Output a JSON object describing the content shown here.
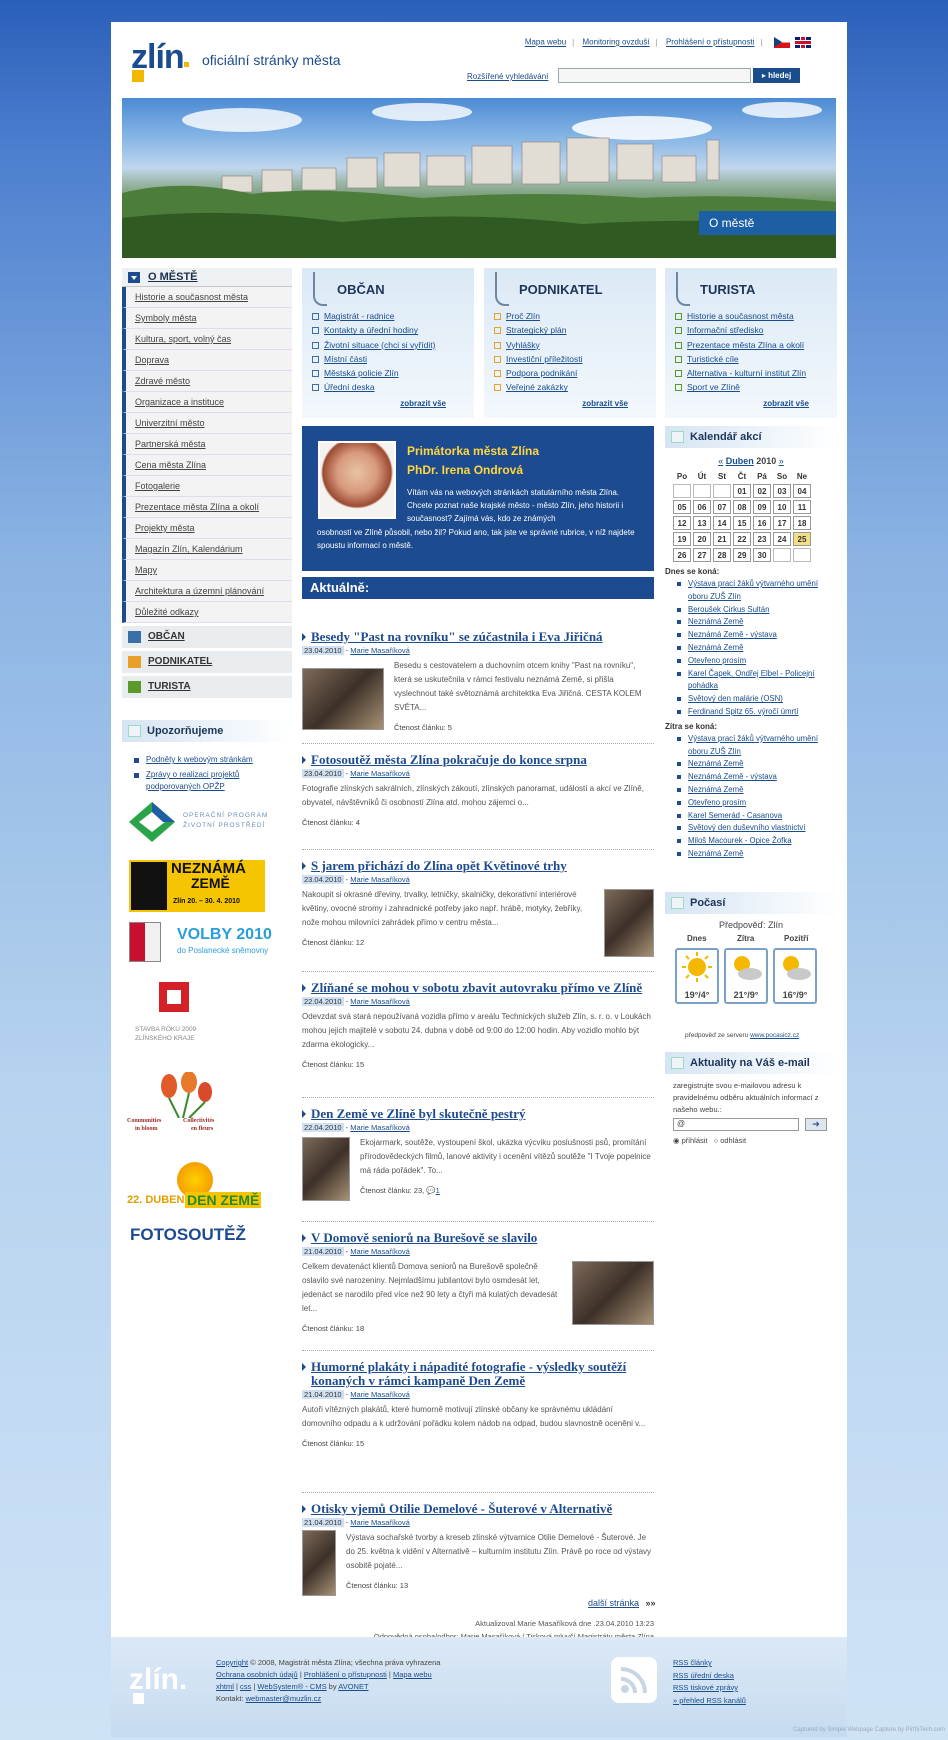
{
  "header": {
    "logo_text": "zlín",
    "tagline": "oficiální stránky města",
    "top_links": [
      "Mapa webu",
      "Monitoring ovzduší",
      "Prohlášení o přístupnosti"
    ],
    "adv_search": "Rozšířené vyhledávání",
    "search_button": "hledej",
    "banner_label": "O městě"
  },
  "left_nav": {
    "heading": "O MĚSTĚ",
    "items": [
      "Historie a současnost města",
      "Symboly města",
      "Kultura, sport, volný čas",
      "Doprava",
      "Zdravé město",
      "Organizace a instituce",
      "Univerzitní město",
      "Partnerská města",
      "Cena města Zlína",
      "Fotogalerie",
      "Prezentace města Zlína a okolí",
      "Projekty města",
      "Magazín Zlín, Kalendárium",
      "Mapy",
      "Architektura a územní plánování",
      "Důležité odkazy"
    ],
    "sections": [
      "OBČAN",
      "PODNIKATEL",
      "TURISTA"
    ]
  },
  "upozornujeme": {
    "heading": "Upozorňujeme",
    "links": [
      "Podněty k webovým stránkám",
      "Zprávy o realizaci projektů podporovaných OPŽP"
    ],
    "promo1_a": "OPERAČNÍ PROGRAM",
    "promo1_b": "ŽIVOTNÍ PROSTŘEDÍ",
    "promo2_a": "NEZNÁMÁ",
    "promo2_b": "ZEMĚ",
    "promo2_c": "Zlín 20. – 30. 4. 2010",
    "promo3_a": "VOLBY 2010",
    "promo3_b": "do Poslanecké sněmovny",
    "promo4_a": "STAVBA ROKU 2009",
    "promo4_b": "ZLÍNSKÉHO KRAJE",
    "promo5_a": "Communities",
    "promo5_b": "in bloom",
    "promo5_c": "Collectivités",
    "promo5_d": "en fleurs",
    "promo6_a": "22. DUBEN",
    "promo6_b": "DEN ZEMĚ",
    "promo7": "FOTOSOUTĚŽ"
  },
  "columns": [
    {
      "title": "OBČAN",
      "color": "#3a6fa8",
      "items": [
        "Magistrát - radnice",
        "Kontakty a úřední hodiny",
        "Životní situace (chci si vyřídit)",
        "Místní části",
        "Městská policie Zlín",
        "Úřední deska"
      ],
      "more": "zobrazit vše"
    },
    {
      "title": "PODNIKATEL",
      "color": "#e8a02a",
      "items": [
        "Proč Zlín",
        "Strategický plán",
        "Vyhlášky",
        "Investiční příležitosti",
        "Podpora podnikání",
        "Veřejné zakázky"
      ],
      "more": "zobrazit vše"
    },
    {
      "title": "TURISTA",
      "color": "#5a9a2a",
      "items": [
        "Historie a současnost města",
        "Informační středisko",
        "Prezentace města Zlína a okolí",
        "Turistické cíle",
        "Alternativa - kulturní institut Zlín",
        "Sport ve Zlíně"
      ],
      "more": "zobrazit vše"
    }
  ],
  "mayor": {
    "title": "Primátorka města Zlína",
    "name": "PhDr. Irena Ondrová",
    "text1": "Vítám vás na webových stránkách statutárního města Zlína. Chcete poznat naše krajské město - město Zlín, jeho historii i současnost? Zajímá vás, kdo ze známých",
    "text2": "osobností ve Zlíně působil, nebo žil? Pokud ano, tak jste ve správné rubrice, v níž najdete spoustu informací o městě."
  },
  "news_heading": "Aktuálně:",
  "news": [
    {
      "title": "Besedy \"Past na rovníku\" se zúčastnila i Eva Jiřičná",
      "date": "23.04.2010",
      "author": "Marie Masaříková",
      "text": "Besedu s cestovatelem a duchovním otcem knihy \"Past na rovníku\", která se uskutečnila v rámci festivalu neznámá Země, si přišla vyslechnout také světoznámá architektka Eva Jiřičná. CESTA KOLEM SVĚTA...",
      "count": "Čtenost článku: 5"
    },
    {
      "title": "Fotosoutěž města Zlína pokračuje do konce srpna",
      "date": "23.04.2010",
      "author": "Marie Masaříková",
      "text": "Fotografie zlínských sakrálních, zlínských zákoutí, zlínských panoramat, událostí a akcí ve Zlíně, obyvatel, návštěvníků či osobností Zlína atd. mohou zájemci o...",
      "count": "Čtenost článku: 4"
    },
    {
      "title": "S jarem přichází do Zlína opět Květinové trhy",
      "date": "23.04.2010",
      "author": "Marie Masaříková",
      "text": "Nakoupit si okrasné dřeviny, trvalky, letničky, skalničky, dekorativní interiérové květiny, ovocné stromy i zahradnické potřeby jako např. hrábě, motyky, žebříky, nože mohou milovníci zahrádek přímo v centru města...",
      "count": "Čtenost článku: 12"
    },
    {
      "title": "Zlíňané se mohou v sobotu zbavit autovraku přímo ve Zlíně",
      "date": "22.04.2010",
      "author": "Marie Masaříková",
      "text": "Odevzdat svá stará nepoužívaná vozidla přímo v areálu Technických služeb Zlín, s. r. o. v Loukách mohou jejich majitelé v sobotu 24. dubna v době od 9:00 do 12:00 hodin. Aby vozidlo mohlo být zdarma ekologicky...",
      "count": "Čtenost článku: 15"
    },
    {
      "title": "Den Země ve Zlíně byl skutečně pestrý",
      "date": "22.04.2010",
      "author": "Marie Masaříková",
      "text": "Ekojarmark, soutěže, vystoupení škol, ukázka výcviku poslušnosti psů, promítání přírodovědeckých filmů, lanové aktivity i ocenění vítězů soutěže \"I Tvoje popelnice má ráda pořádek\". To...",
      "count": "Čtenost článku: 23,",
      "comments": "1"
    },
    {
      "title": "V Domově seniorů na Burešově se slavilo",
      "date": "21.04.2010",
      "author": "Marie Masaříková",
      "text": "Celkem devatenáct klientů Domova seniorů na Burešově společně oslavilo své narozeniny. Nejmladšímu jubilantovi bylo osmdesát let, jedenáct se narodilo před více než 90 lety a čtyři má kulatých devadesát let...",
      "count": "Čtenost článku: 18"
    },
    {
      "title": "Humorné plakáty i nápadité fotografie - výsledky soutěží konaných v rámci kampaně Den Země",
      "date": "21.04.2010",
      "author": "Marie Masaříková",
      "text": "Autoři vítězných plakátů, které humorně motivují zlínské občany ke správnému ukládání domovního odpadu a k udržování pořádku kolem nádob na odpad, budou slavnostně oceněni v...",
      "count": "Čtenost článku: 15"
    },
    {
      "title": "Otisky vjemů Otilie Demelové - Šuterové v Alternativě",
      "date": "21.04.2010",
      "author": "Marie Masaříková",
      "text": "Výstava sochařské tvorby a kreseb zlínské výtvarnice Otilie Demelové - Šuterové. Je do 25. května k vidění v Alternativě – kulturním institutu Zlín. Právě po roce od výstavy osobitě pojaté...",
      "count": "Čtenost článku: 13"
    }
  ],
  "pager": {
    "next": "další stránka",
    "arrows": "»»"
  },
  "updated": "Aktualizoval Marie Masaříková dne  .23.04.2010 13:23",
  "responsible": "Odpovědná osoba/odbor: Marie Masaříková / Tisková mluvčí Magistrátu města Zlína",
  "calendar": {
    "heading": "Kalendář akcí",
    "prev": "«",
    "month": "Duben",
    "year": "2010",
    "next": "»",
    "days": [
      "Po",
      "Út",
      "St",
      "Čt",
      "Pá",
      "So",
      "Ne"
    ],
    "weeks": [
      [
        "",
        "",
        "",
        "01",
        "02",
        "03",
        "04"
      ],
      [
        "05",
        "06",
        "07",
        "08",
        "09",
        "10",
        "11"
      ],
      [
        "12",
        "13",
        "14",
        "15",
        "16",
        "17",
        "18"
      ],
      [
        "19",
        "20",
        "21",
        "22",
        "23",
        "24",
        "25"
      ],
      [
        "26",
        "27",
        "28",
        "29",
        "30",
        "",
        ""
      ]
    ],
    "today": "25",
    "today_label": "Dnes se koná:",
    "today_events": [
      "Výstava prací žáků výtvarného umění oboru ZUŠ Zlín",
      "Beroušek Cirkus Sultán",
      "Neznámá Země",
      "Neznámá Země - výstava",
      "Neznámá Země",
      "Otevřeno prosím",
      "Karel Čapek, Ondřej Elbel - Policejní pohádka",
      "Světový den malárie (OSN)",
      "Ferdinand Spitz 65. výročí úmrtí"
    ],
    "tomorrow_label": "Zítra se koná:",
    "tomorrow_events": [
      "Výstava prací žáků výtvarného umění oboru ZUŠ Zlín",
      "Neznámá Země",
      "Neznámá Země - výstava",
      "Neznámá Země",
      "Otevřeno prosím",
      "Karel Semerád - Casanova",
      "Světový den duševního vlastnictví",
      "Miloš Macourek - Opice Žofka",
      "Neznámá Země"
    ]
  },
  "weather": {
    "heading": "Počasí",
    "forecast": "Předpověď: Zlín",
    "days": [
      {
        "name": "Dnes",
        "temp": "19°/4°"
      },
      {
        "name": "Zítra",
        "temp": "21°/9°"
      },
      {
        "name": "Pozítří",
        "temp": "16°/9°"
      }
    ],
    "source": "předpověď ze serveru",
    "source_link": "www.pocasicz.cz"
  },
  "email": {
    "heading": "Aktuality na Váš e-mail",
    "text": "zaregistrujte svou e-mailovou adresu k pravidelnému odběru aktuálních informací z našeho webu.:",
    "value": "@",
    "subscribe": "přihlásit",
    "unsubscribe": "odhlásit"
  },
  "footer": {
    "logo": "zlín.",
    "copyright": "Copyright",
    "copyright_rest": "© 2008, Magistrát města Zlína; všechna práva vyhrazena",
    "links1": [
      "Ochrana osobních údajů",
      "Prohlášení o přístupnosti",
      "Mapa webu"
    ],
    "links2": [
      "xhtml",
      "css",
      "WebSystem® - CMS"
    ],
    "by": "by",
    "vendor": "AVONET",
    "contact_label": "Kontakt:",
    "contact": "webmaster@muzlin.cz",
    "rss": [
      "RSS články",
      "RSS úřední deska",
      "RSS tiskové zprávy",
      "» přehled RSS kanálů"
    ],
    "capture": "Captured by Simple Webpage Capture by PirthiTech.com"
  }
}
